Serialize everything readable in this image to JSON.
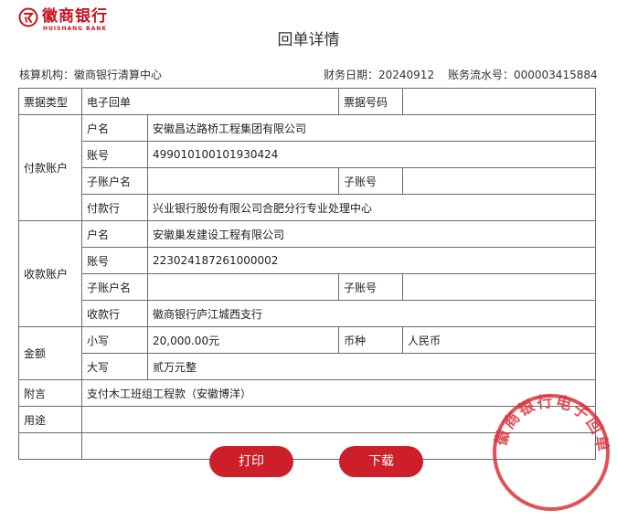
{
  "header": {
    "bank_name": "徽商银行",
    "bank_name_en": "HUISHANG BANK",
    "page_title": "回单详情"
  },
  "meta": {
    "institution": "核算机构：徽商银行清算中心",
    "date": "财务日期：20240912",
    "serial": "账务流水号：000003415884"
  },
  "table": {
    "doc_type_label": "票据类型",
    "doc_type_value": "电子回单",
    "doc_no_label": "票据号码",
    "doc_no_value": "",
    "payer": {
      "group_label": "付款账户",
      "name_label": "户名",
      "name": "安徽昌达路桥工程集团有限公司",
      "account_label": "账号",
      "account": "499010100101930424",
      "sub_name_label": "子账户名",
      "sub_name": "",
      "sub_account_label": "子账号",
      "sub_account": "",
      "bank_label": "付款行",
      "bank": "兴业银行股份有限公司合肥分行专业处理中心"
    },
    "payee": {
      "group_label": "收款账户",
      "name_label": "户名",
      "name": "安徽巢发建设工程有限公司",
      "account_label": "账号",
      "account": "223024187261000002",
      "sub_name_label": "子账户名",
      "sub_name": "",
      "sub_account_label": "子账号",
      "sub_account": "",
      "bank_label": "收款行",
      "bank": "徽商银行庐江城西支行"
    },
    "amount": {
      "group_label": "金额",
      "lower_label": "小写",
      "lower_value": "20,000.00元",
      "currency_label": "币种",
      "currency_value": "人民币",
      "upper_label": "大写",
      "upper_value": "贰万元整"
    },
    "note_label": "附言",
    "note_value": "支付木工班组工程款（安徽博洋）",
    "purpose_label": "用途",
    "purpose_value": ""
  },
  "stamp": {
    "text": "徽商银行电子回单"
  },
  "buttons": {
    "print": "打印",
    "download": "下载"
  },
  "colors": {
    "brand_red": "#c8141e",
    "button_red": "#cc1f2a",
    "border": "#6b6b6b"
  }
}
